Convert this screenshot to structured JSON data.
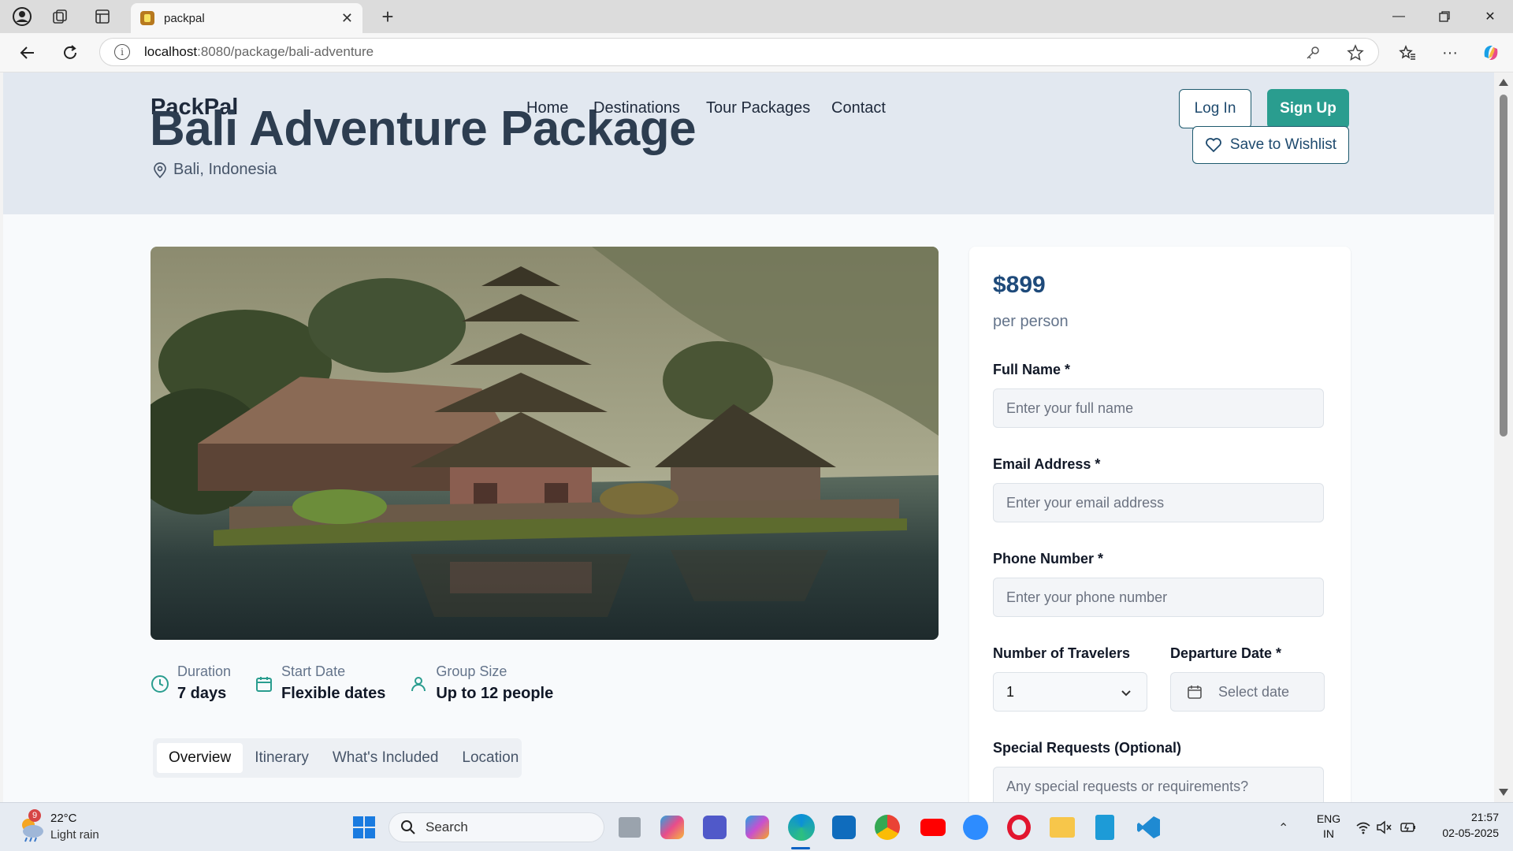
{
  "browser": {
    "tab_title": "packpal",
    "url_host": "localhost",
    "url_path": ":8080/package/bali-adventure"
  },
  "site": {
    "logo": "PackPal",
    "nav": [
      "Home",
      "Destinations",
      "Tour Packages",
      "Contact"
    ],
    "login": "Log In",
    "signup": "Sign Up",
    "wishlist": "Save to Wishlist"
  },
  "package": {
    "title": "Bali Adventure Package",
    "location": "Bali, Indonesia",
    "facts": [
      {
        "label": "Duration",
        "value": "7 days",
        "icon": "clock-icon"
      },
      {
        "label": "Start Date",
        "value": "Flexible dates",
        "icon": "calendar-icon"
      },
      {
        "label": "Group Size",
        "value": "Up to 12 people",
        "icon": "user-icon"
      }
    ],
    "tabs": [
      "Overview",
      "Itinerary",
      "What's Included",
      "Location"
    ],
    "active_tab": "Overview"
  },
  "booking": {
    "price": "$899",
    "per": "per person",
    "full_name_label": "Full Name *",
    "full_name_placeholder": "Enter your full name",
    "email_label": "Email Address *",
    "email_placeholder": "Enter your email address",
    "phone_label": "Phone Number *",
    "phone_placeholder": "Enter your phone number",
    "travelers_label": "Number of Travelers",
    "travelers_value": "1",
    "departure_label": "Departure Date *",
    "departure_placeholder": "Select date",
    "special_label": "Special Requests (Optional)",
    "special_placeholder": "Any special requests or requirements?"
  },
  "taskbar": {
    "weather_temp": "22°C",
    "weather_desc": "Light rain",
    "weather_badge": "9",
    "search": "Search",
    "lang_top": "ENG",
    "lang_bottom": "IN",
    "time": "21:57",
    "date": "02-05-2025"
  },
  "colors": {
    "accent": "#2a9d8f",
    "price": "#1e4a7a",
    "hero_bg": "#e2e8f0"
  }
}
